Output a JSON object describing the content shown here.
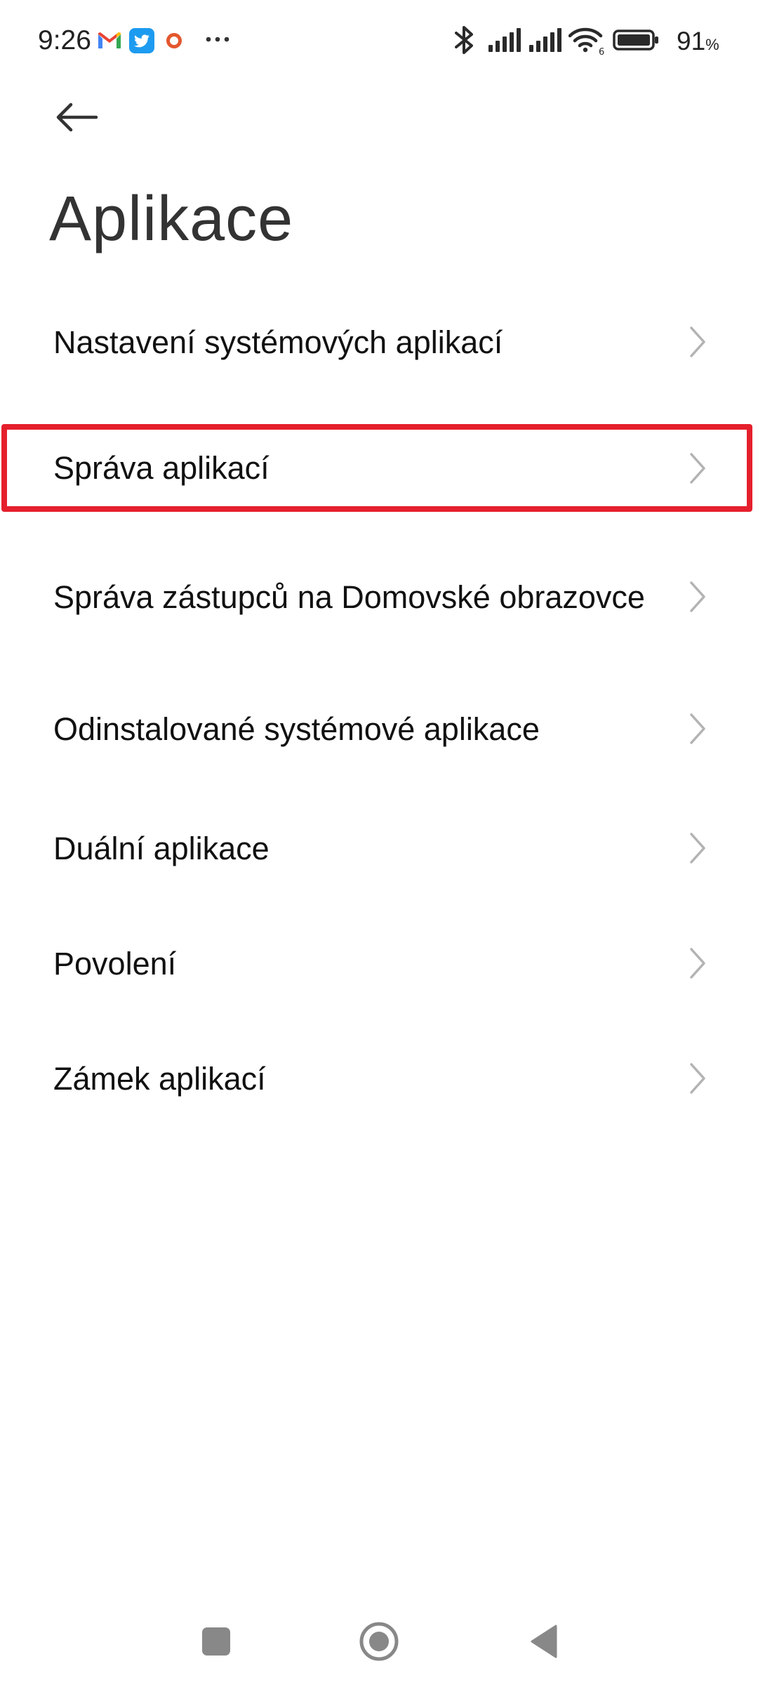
{
  "status_bar": {
    "time": "9:26",
    "battery_percent": "91",
    "battery_unit": "%",
    "notification_icons": [
      "gmail-icon",
      "twitter-icon",
      "notification-circle-icon",
      "more-dots-icon"
    ],
    "system_icons": [
      "bluetooth-icon",
      "signal-icon",
      "signal-icon",
      "wifi-6-icon",
      "battery-icon"
    ],
    "colors": {
      "gmail_red": "#ea4335",
      "gmail_blue": "#4285f4",
      "gmail_green": "#34a853",
      "gmail_yellow": "#fbbc05",
      "twitter_blue": "#1d9bf0",
      "circle_orange": "#e4572e"
    }
  },
  "header": {
    "back_icon": "back-arrow-icon",
    "title": "Aplikace"
  },
  "menu": {
    "items": [
      {
        "label": "Nastavení systémových aplikací"
      },
      {
        "label": "Správa aplikací",
        "highlighted": true
      },
      {
        "label": "Správa zástupců na Domovské obrazovce"
      },
      {
        "label": "Odinstalované systémové aplikace"
      },
      {
        "label": "Duální aplikace"
      },
      {
        "label": "Povolení"
      },
      {
        "label": "Zámek aplikací"
      }
    ],
    "chevron_icon": "chevron-right-icon",
    "highlight_color": "#e5202d"
  },
  "navigation_bar": {
    "buttons": [
      "recents-square-icon",
      "home-circle-icon",
      "back-triangle-icon"
    ]
  }
}
